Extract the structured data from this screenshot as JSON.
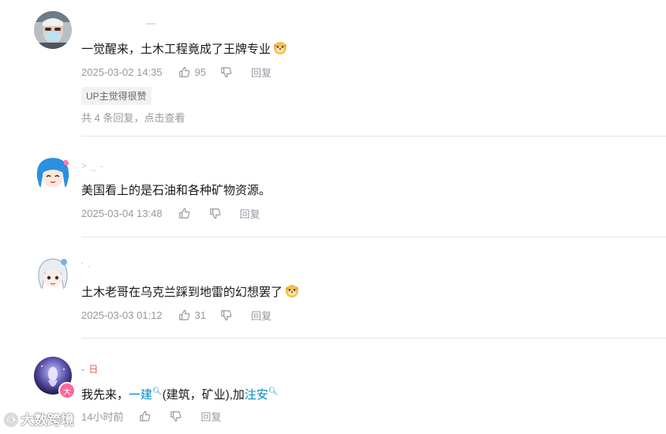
{
  "comments": [
    {
      "username": "— ",
      "text": "一觉醒来，土木工程竟成了王牌专业",
      "time": "2025-03-02 14:35",
      "likes": "95",
      "reply_label": "回复",
      "up_badge": "UP主觉得很赞",
      "reply_summary_prefix": "共 4 条回复，",
      "reply_summary_link": "点击查看"
    },
    {
      "username": "> _ -",
      "text": "美国看上的是石油和各种矿物资源。",
      "time": "2025-03-04 13:48",
      "likes": "",
      "reply_label": "回复"
    },
    {
      "username": "' ·",
      "text": "土木老哥在乌克兰踩到地雷的幻想罢了",
      "time": "2025-03-03 01:12",
      "likes": "31",
      "reply_label": "回复"
    },
    {
      "username": "- 日",
      "text_parts": {
        "a": "我先来，",
        "kw1": "一建",
        "b": "(建筑，矿业),加",
        "kw2": "注安"
      },
      "time": "14小时前",
      "likes": "",
      "reply_label": "回复",
      "avatar_badge": "大"
    }
  ],
  "watermark": {
    "logo": "ⓒ",
    "text": "大数跨境"
  },
  "colors": {
    "text": "#18191c",
    "meta": "#9499a0",
    "keyword": "#008ac5",
    "divider": "#e3e5e7",
    "badge_pink": "#ff6699"
  },
  "icons": [
    "thumb-up-icon",
    "thumb-down-icon",
    "doge-emoji-icon",
    "search-keyword-icon"
  ]
}
